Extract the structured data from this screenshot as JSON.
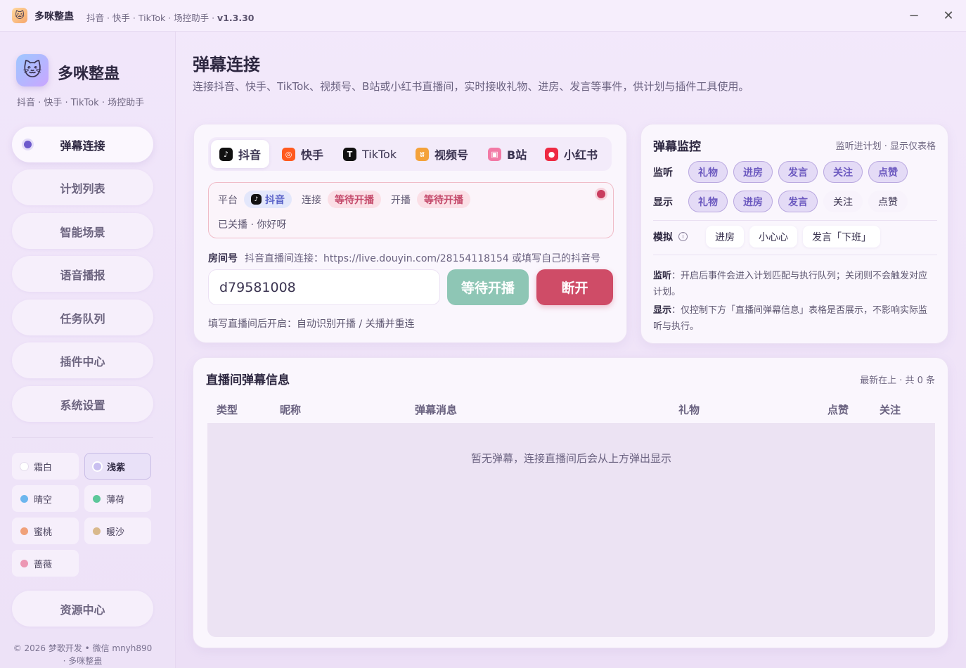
{
  "titlebar": {
    "icon": "cat-face-icon",
    "title": "多咪整蛊",
    "subtitle": "抖音 · 快手 · TikTok · 场控助手 · ",
    "version": "v1.3.30",
    "minimize": "−",
    "close": "✕"
  },
  "sidebar": {
    "brand_name": "多咪整蛊",
    "brand_sub": "抖音 · 快手 · TikTok · 场控助手",
    "nav": [
      {
        "label": "弹幕连接",
        "active": true
      },
      {
        "label": "计划列表"
      },
      {
        "label": "智能场景"
      },
      {
        "label": "语音播报"
      },
      {
        "label": "任务队列"
      },
      {
        "label": "插件中心"
      },
      {
        "label": "系统设置"
      }
    ],
    "themes": [
      {
        "label": "霜白",
        "color": "#ffffff"
      },
      {
        "label": "浅紫",
        "color": "#c9bff0",
        "active": true
      },
      {
        "label": "晴空",
        "color": "#6cb6ee"
      },
      {
        "label": "薄荷",
        "color": "#5cc79a"
      },
      {
        "label": "蜜桃",
        "color": "#f0a17a"
      },
      {
        "label": "暖沙",
        "color": "#d9b98c"
      },
      {
        "label": "蔷薇",
        "color": "#ec97b4"
      }
    ],
    "resource_center": "资源中心",
    "copyright_1": "© 2026 梦歌开发 • 微信 mnyh890",
    "copyright_2": "· 多咪整蛊"
  },
  "page": {
    "title": "弹幕连接",
    "description": "连接抖音、快手、TikTok、视频号、B站或小红书直播间，实时接收礼物、进房、发言等事件，供计划与插件工具使用。"
  },
  "connection": {
    "platforms": [
      {
        "label": "抖音",
        "icon": "douyin-icon",
        "color": "#111111",
        "active": true
      },
      {
        "label": "快手",
        "icon": "kuaishou-icon",
        "color": "#ff5a1f"
      },
      {
        "label": "TikTok",
        "icon": "tiktok-icon",
        "color": "#111111"
      },
      {
        "label": "视频号",
        "icon": "wechat-channels-icon",
        "color": "#f4a23a"
      },
      {
        "label": "B站",
        "icon": "bilibili-icon",
        "color": "#f27aa6"
      },
      {
        "label": "小红书",
        "icon": "xiaohongshu-icon",
        "color": "#ee2a43"
      }
    ],
    "status": {
      "platform_label": "平台",
      "platform_value": "抖音",
      "connect_label": "连接",
      "connect_value": "等待开播",
      "live_label": "开播",
      "live_value": "等待开播",
      "note": "已关播 · 你好呀"
    },
    "room_label": "房间号",
    "room_hint": "抖音直播间连接：https://live.douyin.com/28154118154 或填写自己的抖音号",
    "room_value": "d79581008",
    "wait_button": "等待开播",
    "disconnect_button": "断开",
    "footer_hint": "填写直播间后开启：自动识别开播 / 关播并重连"
  },
  "monitor": {
    "title": "弹幕监控",
    "subtitle": "监听进计划 · 显示仅表格",
    "listen_label": "监听",
    "listen_chips": [
      {
        "label": "礼物",
        "on": true
      },
      {
        "label": "进房",
        "on": true
      },
      {
        "label": "发言",
        "on": true
      },
      {
        "label": "关注",
        "on": true
      },
      {
        "label": "点赞",
        "on": true
      }
    ],
    "display_label": "显示",
    "display_chips": [
      {
        "label": "礼物",
        "on": true
      },
      {
        "label": "进房",
        "on": true
      },
      {
        "label": "发言",
        "on": true
      },
      {
        "label": "关注",
        "on": false
      },
      {
        "label": "点赞",
        "on": false
      }
    ],
    "simulate_label": "模拟",
    "simulate_buttons": [
      "进房",
      "小心心",
      "发言「下班」"
    ],
    "note_listen_key": "监听",
    "note_listen": "：开启后事件会进入计划匹配与执行队列；关闭则不会触发对应计划。",
    "note_display_key": "显示",
    "note_display": "：仅控制下方「直播间弹幕信息」表格是否展示，不影响实际监听与执行。"
  },
  "table": {
    "title": "直播间弹幕信息",
    "subtitle": "最新在上 · 共 0 条",
    "columns": [
      "类型",
      "昵称",
      "弹幕消息",
      "礼物",
      "点赞",
      "关注"
    ],
    "empty": "暂无弹幕，连接直播间后会从上方弹出显示"
  }
}
